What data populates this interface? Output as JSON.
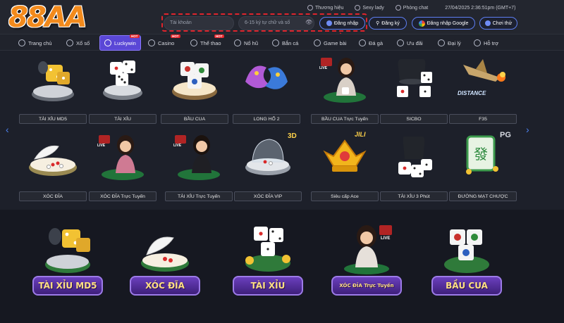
{
  "brand": {
    "logo_text": "88AA"
  },
  "toplinks": [
    {
      "label": "Thương hiệu"
    },
    {
      "label": "Sexy lady"
    },
    {
      "label": "Phòng chat"
    }
  ],
  "datetime": "27/04/2025 2:36:51pm  (GMT+7)",
  "login": {
    "username_placeholder": "Tài khoản",
    "password_placeholder": "6-15 ký tự chữ và số",
    "login_label": "Đăng nhập",
    "register_label": "Đăng ký",
    "google_label": "Đăng nhập Google",
    "try_label": "Chơi thử"
  },
  "nav": [
    {
      "label": "Trang chủ"
    },
    {
      "label": "Xổ số"
    },
    {
      "label": "Luckywin",
      "badge": "HOT"
    },
    {
      "label": "Casino",
      "badge": "HOT"
    },
    {
      "label": "Thể thao",
      "badge": "HOT"
    },
    {
      "label": "Nổ hũ"
    },
    {
      "label": "Bắn cá"
    },
    {
      "label": "Game bài"
    },
    {
      "label": "Đá gà"
    },
    {
      "label": "Ưu đãi"
    },
    {
      "label": "Đại lý"
    },
    {
      "label": "Hỗ trợ"
    }
  ],
  "games_row1": [
    {
      "label": "TÀI XỈU MD5",
      "icon": "dice-cup-icon"
    },
    {
      "label": "TÀI XỈU",
      "icon": "dice-icon"
    },
    {
      "label": "BẦU CUA",
      "icon": "bau-cua-dice-icon"
    },
    {
      "label": "LONG HỔ 2",
      "icon": "dragon-tiger-icon"
    },
    {
      "label": "BẦU CUA Trực Tuyến",
      "icon": "live-dealer-icon",
      "live": "LIVE"
    },
    {
      "label": "SICBO",
      "icon": "sicbo-cup-icon"
    },
    {
      "label": "F35",
      "icon": "jet-icon",
      "tag": "DISTANCE"
    }
  ],
  "games_row2": [
    {
      "label": "XÓC ĐĨA",
      "icon": "plate-bowl-icon"
    },
    {
      "label": "XÓC ĐĨA Trực Tuyến",
      "icon": "live-dealer-icon",
      "live": "LIVE"
    },
    {
      "label": "TÀI XỈU Trực Tuyến",
      "icon": "live-dealer-icon",
      "live": "LIVE"
    },
    {
      "label": "XÓC ĐĨA VIP",
      "icon": "glass-bowl-icon",
      "tag": "3D"
    },
    {
      "label": "Siêu cấp Ace",
      "icon": "crown-icon",
      "tag": "JILI"
    },
    {
      "label": "TÀI XỈU 3 Phút",
      "icon": "dice-cup-icon"
    },
    {
      "label": "ĐƯỜNG MẠT CHƯỢC",
      "icon": "mahjong-tile-icon",
      "tag": "PG"
    }
  ],
  "banners": [
    {
      "label": "TÀI XỈU MD5"
    },
    {
      "label": "XÓC ĐĨA"
    },
    {
      "label": "TÀI XỈU"
    },
    {
      "label": "XÓC ĐĨA Trực Tuyến",
      "live": "LIVE"
    },
    {
      "label": "BẦU CUA"
    }
  ],
  "colors": {
    "accent": "#5a47d6",
    "logo": "#f28a1c",
    "highlight": "#e0242c",
    "link_blue": "#4d82f0"
  }
}
